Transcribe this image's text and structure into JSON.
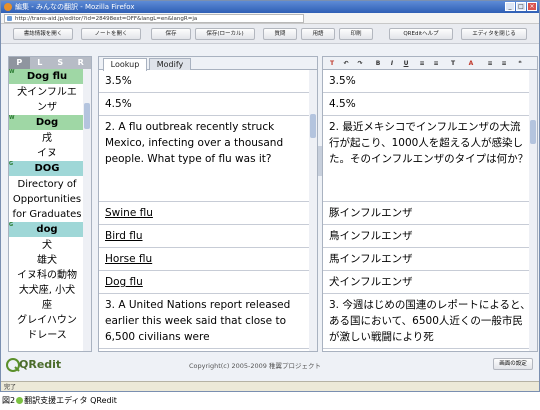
{
  "window": {
    "title": "編集 - みんなの翻訳 - Mozilla Firefox",
    "controls": [
      "_",
      "□",
      "×"
    ]
  },
  "urlbar": {
    "url": "http://trans-aid.jp/editor/?id=28498ext=OFF&langL=en&langR=ja"
  },
  "toolbar": {
    "buttons": [
      "書誌情報を開く",
      "ノートを開く",
      "保存",
      "保存(ローカル)",
      "質問",
      "用語",
      "印刷",
      "QREditヘルプ",
      "エディタを閉じる"
    ]
  },
  "dictionary": {
    "tabs": [
      "P",
      "L",
      "S",
      "R"
    ],
    "entries": [
      {
        "mark": "W",
        "head": "Dog flu",
        "style": "g",
        "trans": [
          "犬インフルエ",
          "ンザ"
        ]
      },
      {
        "mark": "W",
        "head": "Dog",
        "style": "g",
        "trans": [
          "戌",
          "イヌ"
        ]
      },
      {
        "mark": "G",
        "head": "DOG",
        "style": "c",
        "trans": [
          "Directory of",
          "Opportunities",
          "for Graduates"
        ]
      },
      {
        "mark": "G",
        "head": "dog",
        "style": "c",
        "trans": [
          "犬",
          "雄犬",
          "イヌ科の動物",
          "大犬座, 小犬",
          "座",
          "グレイハウン",
          "ドレース"
        ]
      }
    ]
  },
  "left_pane": {
    "tabs": [
      "Lookup",
      "Modify"
    ],
    "segments": [
      "3.5%",
      "4.5%",
      "2. A flu outbreak recently struck Mexico, infecting over a thousand people. What type of flu was it?",
      "Swine flu",
      "Bird flu",
      "Horse flu",
      "Dog flu",
      "3. A United Nations report released earlier this week said that close to 6,500 civilians were"
    ]
  },
  "right_pane": {
    "toolbar": [
      "T",
      "↶",
      "↷",
      "B",
      "I",
      "U",
      "≡",
      "≡",
      "T",
      "A",
      "≡",
      "≡",
      "❝"
    ],
    "segments": [
      "3.5%",
      "4.5%",
      "2. 最近メキシコでインフルエンザの大流行が起こり、1000人を超える人が感染した。そのインフルエンザのタイプは何か？",
      "豚インフルエンザ",
      "鳥インフルエンザ",
      "馬インフルエンザ",
      "犬インフルエンザ",
      "3. 今週はじめの国連のレポートによると、ある国において、6500人近くの一般市民が激しい戦闘により死"
    ]
  },
  "footer": {
    "logo": "QRedit",
    "copyright": "Copyright(c) 2005-2009 稚翼プロジェクト",
    "settings": "画面の設定"
  },
  "status": {
    "text": "完了"
  },
  "caption": {
    "fig": "図2",
    "text": "翻訳支援エディタ QRedit"
  }
}
